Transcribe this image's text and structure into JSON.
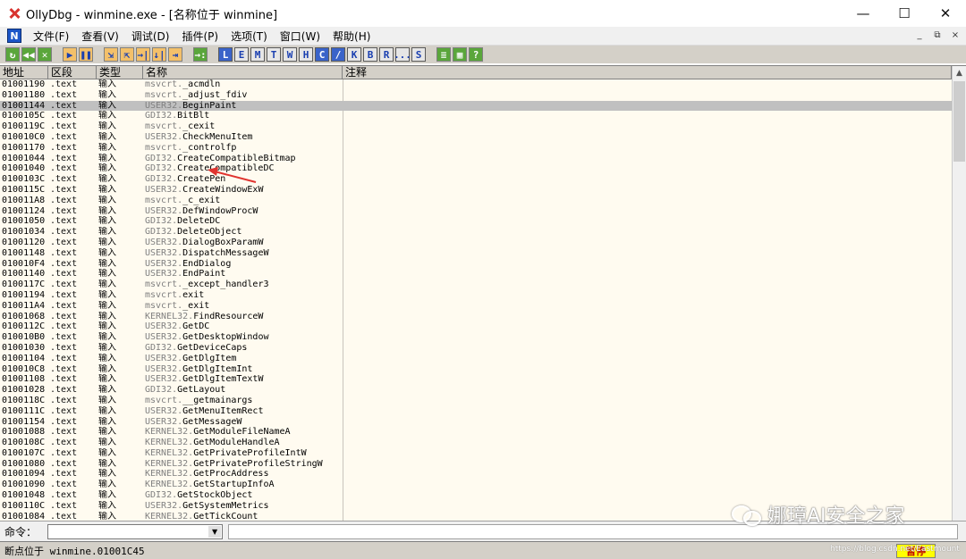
{
  "window": {
    "title": "OllyDbg - winmine.exe - [名称位于 winmine]",
    "minimize": "—",
    "maximize": "☐",
    "close": "✕"
  },
  "menu": {
    "items": [
      "文件(F)",
      "查看(V)",
      "调试(D)",
      "插件(P)",
      "选项(T)",
      "窗口(W)",
      "帮助(H)"
    ],
    "icon_letter": "N",
    "mdi": [
      "_",
      "⧉",
      "×"
    ]
  },
  "toolbar": {
    "run_controls": [
      "↻",
      "◀◀",
      "✕",
      "▶",
      "❚❚"
    ],
    "step_controls": [
      "⇲",
      "⇱",
      "→|",
      "↓|",
      "⇥",
      "→:"
    ],
    "letters": [
      "L",
      "E",
      "M",
      "T",
      "W",
      "H",
      "C",
      "/",
      "K",
      "B",
      "R",
      "...",
      "S"
    ],
    "extra": [
      "≡",
      "▦",
      "?"
    ]
  },
  "list": {
    "headers": [
      "地址",
      "区段",
      "类型",
      "名称",
      "注释"
    ],
    "selected_index": 2,
    "rows": [
      {
        "addr": "01001190",
        "sec": ".text",
        "type": "输入",
        "mod": "msvcrt.",
        "fn": "_acmdln"
      },
      {
        "addr": "01001180",
        "sec": ".text",
        "type": "输入",
        "mod": "msvcrt.",
        "fn": "_adjust_fdiv"
      },
      {
        "addr": "01001144",
        "sec": ".text",
        "type": "输入",
        "mod": "USER32.",
        "fn": "BeginPaint"
      },
      {
        "addr": "0100105C",
        "sec": ".text",
        "type": "输入",
        "mod": "GDI32.",
        "fn": "BitBlt"
      },
      {
        "addr": "0100119C",
        "sec": ".text",
        "type": "输入",
        "mod": "msvcrt.",
        "fn": "_cexit"
      },
      {
        "addr": "010010C0",
        "sec": ".text",
        "type": "输入",
        "mod": "USER32.",
        "fn": "CheckMenuItem"
      },
      {
        "addr": "01001170",
        "sec": ".text",
        "type": "输入",
        "mod": "msvcrt.",
        "fn": "_controlfp"
      },
      {
        "addr": "01001044",
        "sec": ".text",
        "type": "输入",
        "mod": "GDI32.",
        "fn": "CreateCompatibleBitmap"
      },
      {
        "addr": "01001040",
        "sec": ".text",
        "type": "输入",
        "mod": "GDI32.",
        "fn": "CreateCompatibleDC"
      },
      {
        "addr": "0100103C",
        "sec": ".text",
        "type": "输入",
        "mod": "GDI32.",
        "fn": "CreatePen"
      },
      {
        "addr": "0100115C",
        "sec": ".text",
        "type": "输入",
        "mod": "USER32.",
        "fn": "CreateWindowExW"
      },
      {
        "addr": "010011A8",
        "sec": ".text",
        "type": "输入",
        "mod": "msvcrt.",
        "fn": "_c_exit"
      },
      {
        "addr": "01001124",
        "sec": ".text",
        "type": "输入",
        "mod": "USER32.",
        "fn": "DefWindowProcW"
      },
      {
        "addr": "01001050",
        "sec": ".text",
        "type": "输入",
        "mod": "GDI32.",
        "fn": "DeleteDC"
      },
      {
        "addr": "01001034",
        "sec": ".text",
        "type": "输入",
        "mod": "GDI32.",
        "fn": "DeleteObject"
      },
      {
        "addr": "01001120",
        "sec": ".text",
        "type": "输入",
        "mod": "USER32.",
        "fn": "DialogBoxParamW"
      },
      {
        "addr": "01001148",
        "sec": ".text",
        "type": "输入",
        "mod": "USER32.",
        "fn": "DispatchMessageW"
      },
      {
        "addr": "010010F4",
        "sec": ".text",
        "type": "输入",
        "mod": "USER32.",
        "fn": "EndDialog"
      },
      {
        "addr": "01001140",
        "sec": ".text",
        "type": "输入",
        "mod": "USER32.",
        "fn": "EndPaint"
      },
      {
        "addr": "0100117C",
        "sec": ".text",
        "type": "输入",
        "mod": "msvcrt.",
        "fn": "_except_handler3"
      },
      {
        "addr": "01001194",
        "sec": ".text",
        "type": "输入",
        "mod": "msvcrt.",
        "fn": "exit"
      },
      {
        "addr": "010011A4",
        "sec": ".text",
        "type": "输入",
        "mod": "msvcrt.",
        "fn": "_exit"
      },
      {
        "addr": "01001068",
        "sec": ".text",
        "type": "输入",
        "mod": "KERNEL32.",
        "fn": "FindResourceW"
      },
      {
        "addr": "0100112C",
        "sec": ".text",
        "type": "输入",
        "mod": "USER32.",
        "fn": "GetDC"
      },
      {
        "addr": "010010B0",
        "sec": ".text",
        "type": "输入",
        "mod": "USER32.",
        "fn": "GetDesktopWindow"
      },
      {
        "addr": "01001030",
        "sec": ".text",
        "type": "输入",
        "mod": "GDI32.",
        "fn": "GetDeviceCaps"
      },
      {
        "addr": "01001104",
        "sec": ".text",
        "type": "输入",
        "mod": "USER32.",
        "fn": "GetDlgItem"
      },
      {
        "addr": "010010C8",
        "sec": ".text",
        "type": "输入",
        "mod": "USER32.",
        "fn": "GetDlgItemInt"
      },
      {
        "addr": "01001108",
        "sec": ".text",
        "type": "输入",
        "mod": "USER32.",
        "fn": "GetDlgItemTextW"
      },
      {
        "addr": "01001028",
        "sec": ".text",
        "type": "输入",
        "mod": "GDI32.",
        "fn": "GetLayout"
      },
      {
        "addr": "0100118C",
        "sec": ".text",
        "type": "输入",
        "mod": "msvcrt.",
        "fn": "__getmainargs"
      },
      {
        "addr": "0100111C",
        "sec": ".text",
        "type": "输入",
        "mod": "USER32.",
        "fn": "GetMenuItemRect"
      },
      {
        "addr": "01001154",
        "sec": ".text",
        "type": "输入",
        "mod": "USER32.",
        "fn": "GetMessageW"
      },
      {
        "addr": "01001088",
        "sec": ".text",
        "type": "输入",
        "mod": "KERNEL32.",
        "fn": "GetModuleFileNameA"
      },
      {
        "addr": "0100108C",
        "sec": ".text",
        "type": "输入",
        "mod": "KERNEL32.",
        "fn": "GetModuleHandleA"
      },
      {
        "addr": "0100107C",
        "sec": ".text",
        "type": "输入",
        "mod": "KERNEL32.",
        "fn": "GetPrivateProfileIntW"
      },
      {
        "addr": "01001080",
        "sec": ".text",
        "type": "输入",
        "mod": "KERNEL32.",
        "fn": "GetPrivateProfileStringW"
      },
      {
        "addr": "01001094",
        "sec": ".text",
        "type": "输入",
        "mod": "KERNEL32.",
        "fn": "GetProcAddress"
      },
      {
        "addr": "01001090",
        "sec": ".text",
        "type": "输入",
        "mod": "KERNEL32.",
        "fn": "GetStartupInfoA"
      },
      {
        "addr": "01001048",
        "sec": ".text",
        "type": "输入",
        "mod": "GDI32.",
        "fn": "GetStockObject"
      },
      {
        "addr": "0100110C",
        "sec": ".text",
        "type": "输入",
        "mod": "USER32.",
        "fn": "GetSystemMetrics"
      },
      {
        "addr": "01001084",
        "sec": ".text",
        "type": "输入",
        "mod": "KERNEL32.",
        "fn": "GetTickCount"
      }
    ]
  },
  "command": {
    "label": "命令：",
    "value": ""
  },
  "status": {
    "text": "断点位于 winmine.01001C45",
    "state": "暂停"
  },
  "watermark": {
    "text": "娜璋AI安全之家",
    "url": "https://blog.csdn.net/Eastmount"
  },
  "colors": {
    "list_bg": "#fffbf0",
    "selected_row": "#c0c0c0",
    "annotation_arrow": "#e0342f",
    "paused_bg": "#ffff00"
  }
}
